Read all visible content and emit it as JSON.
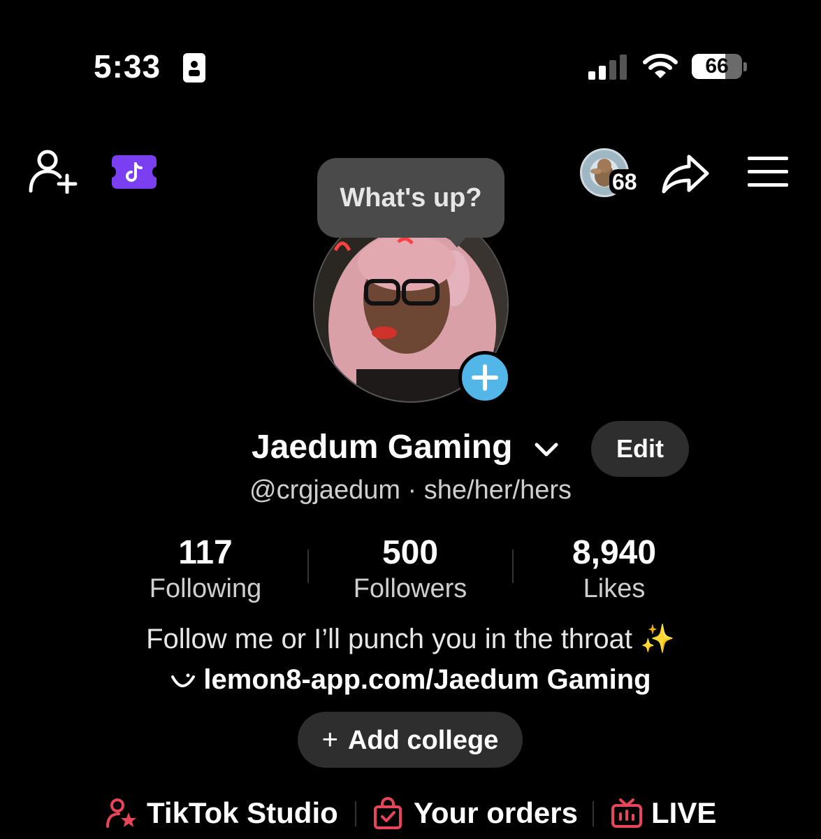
{
  "status_bar": {
    "time": "5:33",
    "battery": "66",
    "battery_level": 0.66
  },
  "nav": {
    "story_count": "68"
  },
  "tooltip": {
    "text": "What's up?"
  },
  "profile": {
    "name": "Jaedum Gaming",
    "edit_label": "Edit",
    "handle_line": "@crgjaedum · she/her/hers"
  },
  "stats": [
    {
      "value": "117",
      "label": "Following"
    },
    {
      "value": "500",
      "label": "Followers"
    },
    {
      "value": "8,940",
      "label": "Likes"
    }
  ],
  "bio": {
    "text": "Follow me or I’ll punch you in the throat",
    "emoji": "✨",
    "link": "lemon8-app.com/Jaedum Gaming"
  },
  "add_college": {
    "label": "Add college",
    "icon": "+"
  },
  "bottom_links": [
    {
      "label": "TikTok Studio",
      "icon": "studio-icon"
    },
    {
      "label": "Your orders",
      "icon": "orders-bag-icon"
    },
    {
      "label": "LIVE",
      "icon": "live-tv-icon"
    }
  ],
  "colors": {
    "accent_blue": "#52b7e8",
    "ticket_purple": "#7b3ff2",
    "bottom_icon_red": "#e8455a"
  }
}
